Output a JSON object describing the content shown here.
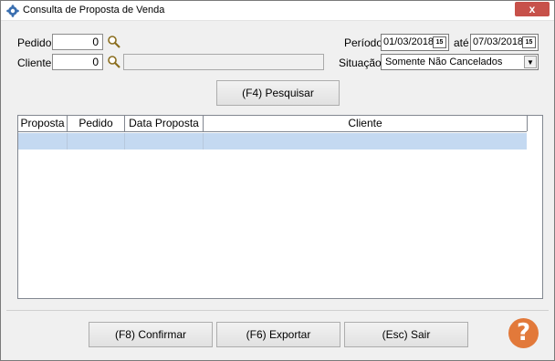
{
  "window": {
    "title": "Consulta de Proposta de Venda",
    "close_glyph": "x",
    "icon": "app-gear-icon"
  },
  "filters": {
    "pedido_label": "Pedido:",
    "pedido_value": "0",
    "cliente_label": "Cliente:",
    "cliente_value": "0",
    "cliente_name_value": "",
    "periodo_label": "Período:",
    "periodo_start": "01/03/2018",
    "ate_label": "até",
    "periodo_end": "07/03/2018",
    "calendar_glyph": "15",
    "situacao_label": "Situação:",
    "situacao_value": "Somente Não Cancelados",
    "search_button": "(F4) Pesquisar"
  },
  "grid": {
    "columns": [
      "Proposta",
      "Pedido",
      "Data Proposta",
      "Cliente"
    ],
    "rows": [],
    "selected_row_color": "#c4d9f1"
  },
  "footer": {
    "confirm_button": "(F8) Confirmar",
    "export_button": "(F6) Exportar",
    "exit_button": "(Esc) Sair",
    "help_glyph": "?",
    "help_color": "#e2793a"
  }
}
